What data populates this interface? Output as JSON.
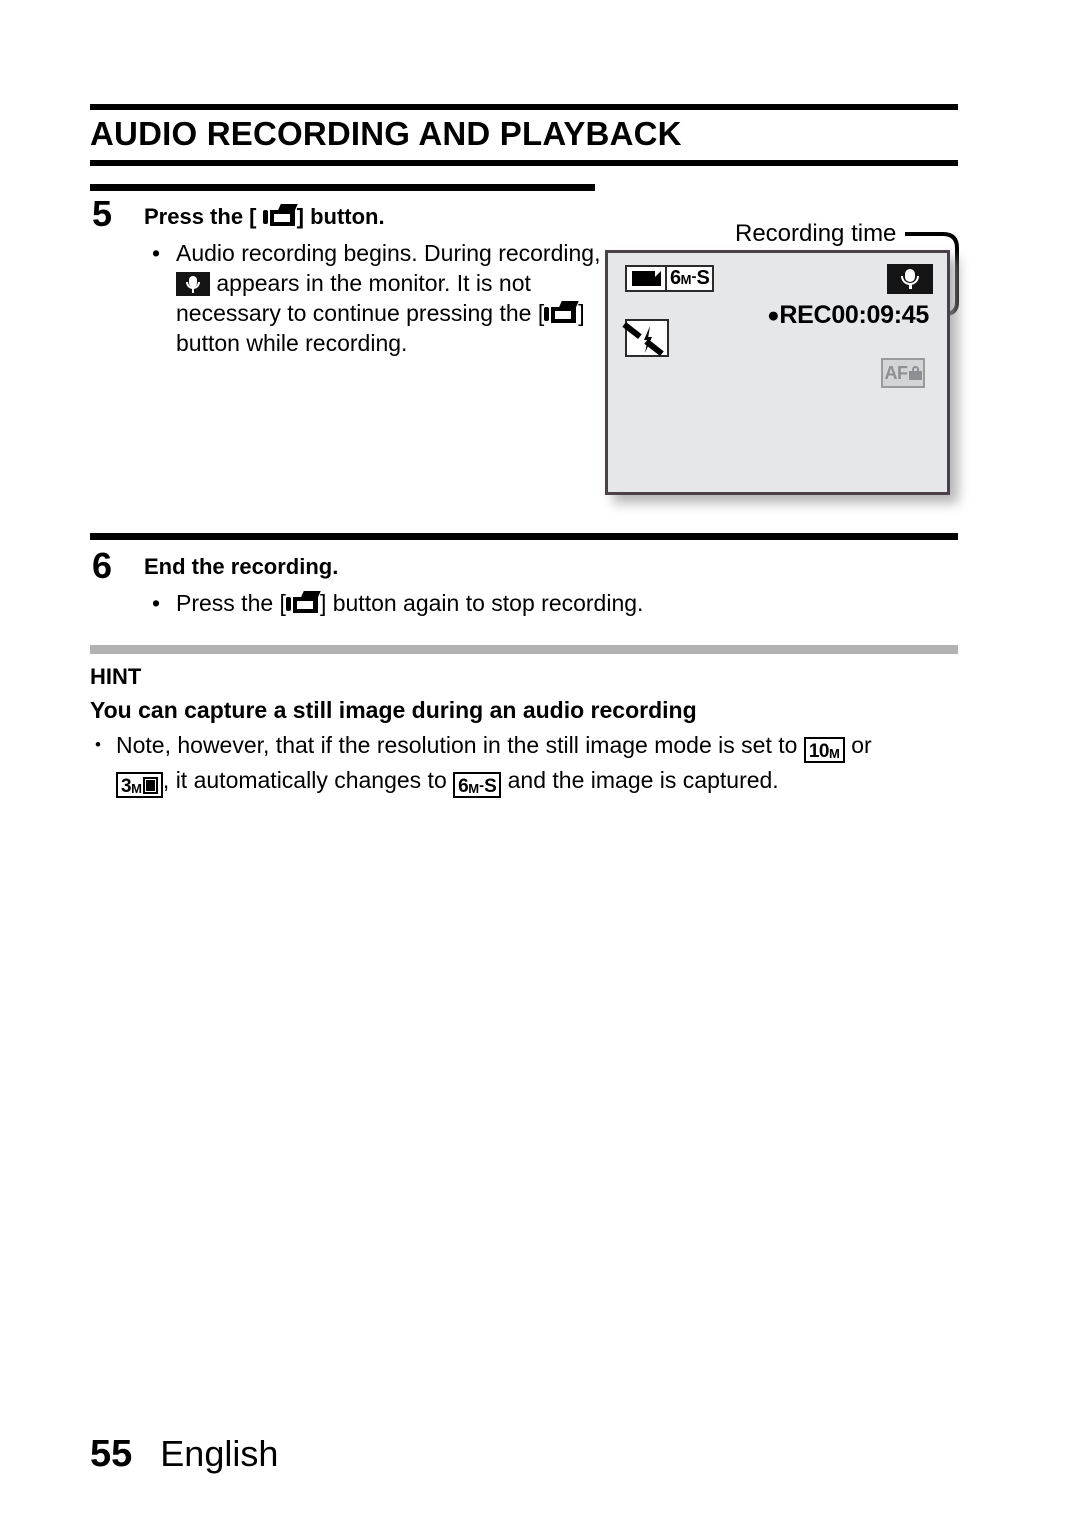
{
  "chapter": {
    "title": "AUDIO RECORDING AND PLAYBACK"
  },
  "steps": [
    {
      "number": "5",
      "title_before_icon": "Press the [",
      "title_icon": "camcorder-icon",
      "title_after_icon": "] button.",
      "bullet_marker": "•",
      "bullet_part1": "Audio recording begins. During recording,",
      "bullet_icon": "microphone-icon",
      "bullet_part2": "appears in the monitor.",
      "bullet_part3": "It is not necessary to continue pressing the [",
      "bullet_part4": "] button while recording."
    },
    {
      "number": "6",
      "title": "End the recording.",
      "bullet_marker": "•",
      "bullet_part1": "Press the [",
      "bullet_part2": "] button again to stop recording."
    }
  ],
  "hint": {
    "label": "HINT",
    "heading": "You can capture a still image during an audio recording",
    "bullet_marker": "•",
    "text_part1": "Note, however, that if the resolution in the still image mode is set to",
    "chip_10m": {
      "big": "10",
      "small": "M"
    },
    "text_part2": "or",
    "chip_3m": {
      "big": "3",
      "small": "M",
      "square": "filled-square-icon"
    },
    "text_part3": ", it automatically changes to",
    "chip_6ms": {
      "big": "6",
      "small": "M",
      "dash": "-",
      "suffix": "S"
    },
    "text_part4": "and the image is captured."
  },
  "monitor": {
    "callout_label": "Recording time",
    "battery_icon": "battery-full-icon",
    "resolution": {
      "big": "6",
      "small": "M",
      "dash": "-",
      "suffix": "S"
    },
    "flash_icon": "flash-off-icon",
    "mic_icon": "microphone-icon",
    "rec_dot": "●",
    "rec_label": "REC",
    "rec_time": "00:09:45",
    "af_lock_text": "AF",
    "af_lock_icon": "lock-icon"
  },
  "footer": {
    "page_number": "55",
    "language": "English"
  },
  "colors": {
    "text": "#000000",
    "monitor_bg": "#e6e7e9",
    "monitor_border": "#4a4248",
    "hint_rule": "#b2b2b2",
    "badge_bg": "#141414",
    "aflock_gray": "#8d8f93"
  }
}
